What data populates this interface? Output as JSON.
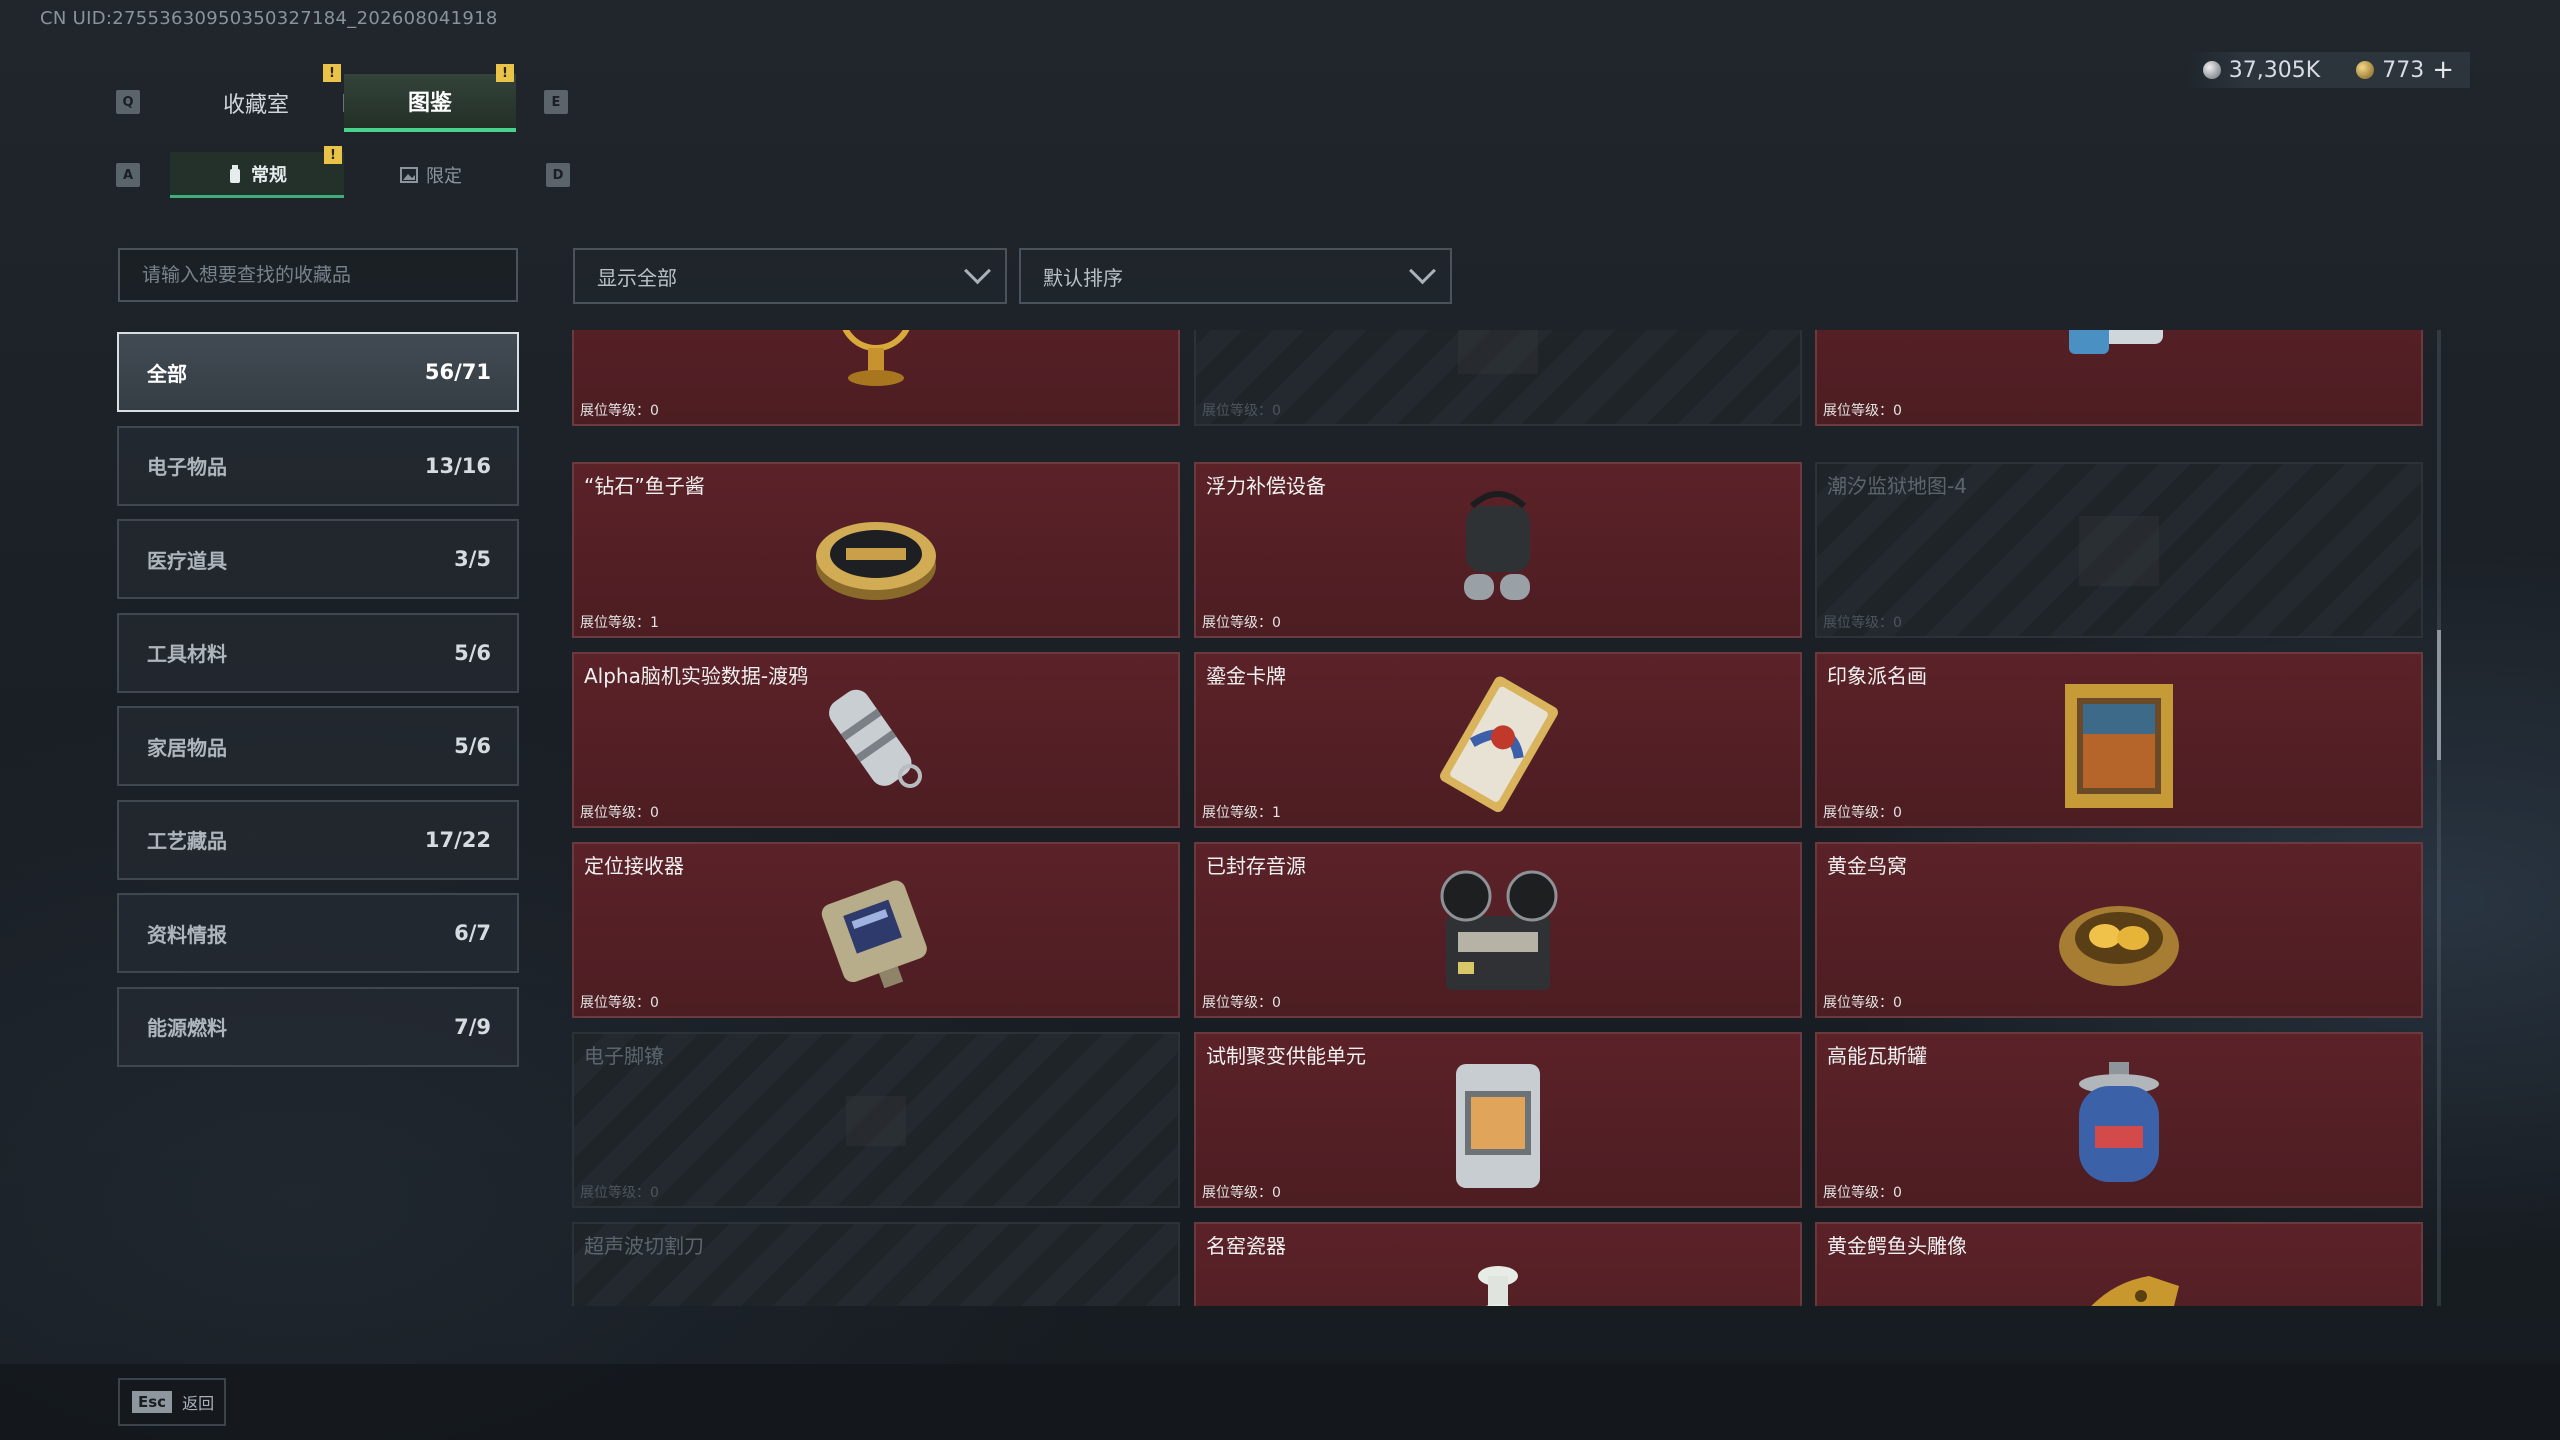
{
  "uid": "CN UID:27553630950350327184_202608041918",
  "keys": {
    "q": "Q",
    "e": "E",
    "a": "A",
    "d": "D"
  },
  "tabs": [
    {
      "label": "收藏室"
    },
    {
      "label": "图鉴"
    }
  ],
  "subtabs": [
    {
      "label": "常规"
    },
    {
      "label": "限定"
    }
  ],
  "badge": "!",
  "currency": {
    "silver": "37,305K",
    "gold": "773",
    "add": "+"
  },
  "search": {
    "placeholder": "请输入想要查找的收藏品"
  },
  "filters": {
    "show": "显示全部",
    "sort": "默认排序"
  },
  "categories": [
    {
      "label": "全部",
      "count": "56/71"
    },
    {
      "label": "电子物品",
      "count": "13/16"
    },
    {
      "label": "医疗道具",
      "count": "3/5"
    },
    {
      "label": "工具材料",
      "count": "5/6"
    },
    {
      "label": "家居物品",
      "count": "5/6"
    },
    {
      "label": "工艺藏品",
      "count": "17/22"
    },
    {
      "label": "资料情报",
      "count": "6/7"
    },
    {
      "label": "能源燃料",
      "count": "7/9"
    }
  ],
  "cards": [
    {
      "name": "",
      "level": "展位等级：0",
      "locked": false,
      "icon": "armillary-sphere-icon"
    },
    {
      "name": "",
      "level": "展位等级：0",
      "locked": true,
      "icon": "map-icon"
    },
    {
      "name": "",
      "level": "展位等级：0",
      "locked": false,
      "icon": "device-icon"
    },
    {
      "name": "“钻石”鱼子酱",
      "level": "展位等级：1",
      "locked": false,
      "icon": "caviar-tin-icon"
    },
    {
      "name": "浮力补偿设备",
      "level": "展位等级：0",
      "locked": false,
      "icon": "buoyancy-device-icon"
    },
    {
      "name": "潮汐监狱地图-4",
      "level": "展位等级：0",
      "locked": true,
      "icon": "map-icon"
    },
    {
      "name": "Alpha脑机实验数据-渡鸦",
      "level": "展位等级：0",
      "locked": false,
      "icon": "data-cylinder-icon"
    },
    {
      "name": "鎏金卡牌",
      "level": "展位等级：1",
      "locked": false,
      "icon": "gold-card-icon"
    },
    {
      "name": "印象派名画",
      "level": "展位等级：0",
      "locked": false,
      "icon": "painting-icon"
    },
    {
      "name": "定位接收器",
      "level": "展位等级：0",
      "locked": false,
      "icon": "receiver-icon"
    },
    {
      "name": "已封存音源",
      "level": "展位等级：0",
      "locked": false,
      "icon": "tape-recorder-icon"
    },
    {
      "name": "黄金鸟窝",
      "level": "展位等级：0",
      "locked": false,
      "icon": "golden-nest-icon"
    },
    {
      "name": "电子脚镣",
      "level": "展位等级：0",
      "locked": true,
      "icon": "ankle-monitor-icon"
    },
    {
      "name": "试制聚变供能单元",
      "level": "展位等级：0",
      "locked": false,
      "icon": "fusion-unit-icon"
    },
    {
      "name": "高能瓦斯罐",
      "level": "展位等级：0",
      "locked": false,
      "icon": "gas-canister-icon"
    },
    {
      "name": "超声波切割刀",
      "level": "",
      "locked": true,
      "icon": "cutter-icon"
    },
    {
      "name": "名窑瓷器",
      "level": "",
      "locked": false,
      "icon": "porcelain-icon"
    },
    {
      "name": "黄金鳄鱼头雕像",
      "level": "",
      "locked": false,
      "icon": "crocodile-statue-icon"
    }
  ],
  "footer": {
    "esc_key": "Esc",
    "esc_label": "返回"
  }
}
